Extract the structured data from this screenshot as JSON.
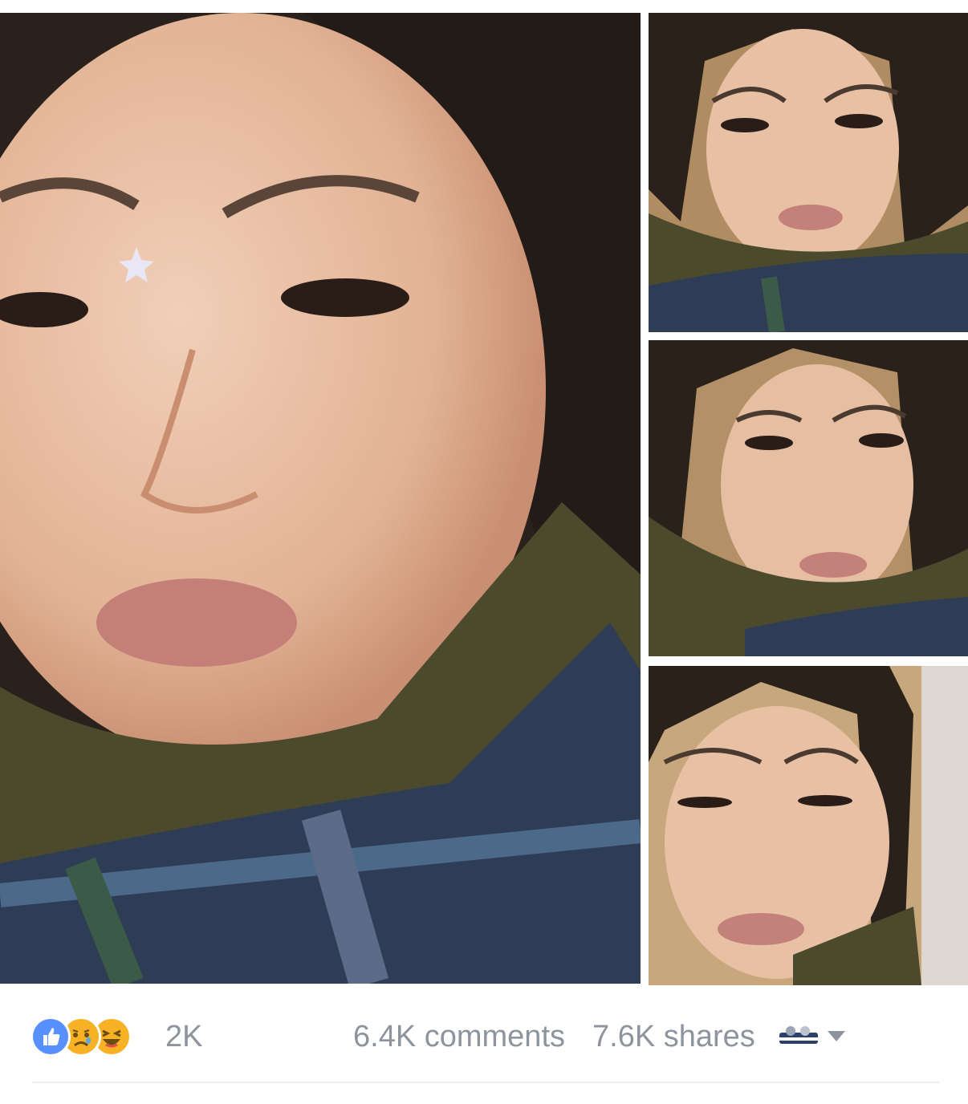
{
  "photos": [
    {
      "name": "main-photo"
    },
    {
      "name": "thumbnail-1"
    },
    {
      "name": "thumbnail-2"
    },
    {
      "name": "thumbnail-3"
    }
  ],
  "reactions": {
    "icons": [
      "like-icon",
      "sad-icon",
      "haha-icon"
    ],
    "colors": {
      "like": "#5890ff",
      "emoji": "#f7b125"
    },
    "count": "2K"
  },
  "stats": {
    "comments": "6.4K comments",
    "shares": "7.6K shares"
  },
  "audience": {
    "icons": [
      "audience-selector-icon",
      "caret-down-icon"
    ]
  },
  "colors": {
    "text_muted": "#8d949e",
    "background": "#ffffff"
  }
}
